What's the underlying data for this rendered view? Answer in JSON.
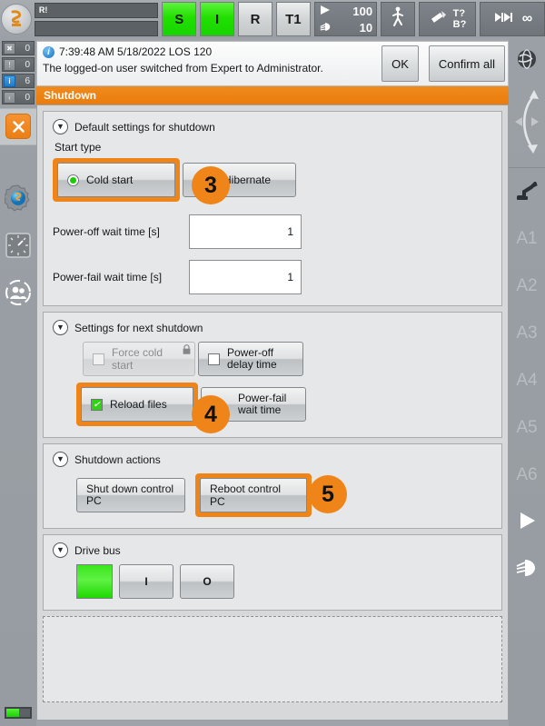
{
  "topbar": {
    "logo_icon": "kuka-robot-logo-icon",
    "status_field_1": "R!",
    "status_field_2": "",
    "buttons": [
      {
        "name": "submit-interpreter",
        "label": "S",
        "style": "green"
      },
      {
        "name": "drives-ready",
        "label": "I",
        "style": "green"
      },
      {
        "name": "robot-interpreter",
        "label": "R",
        "style": "gray"
      },
      {
        "name": "operating-mode",
        "label": "T1",
        "style": "gray"
      }
    ],
    "program_override": "100",
    "jog_override": "10",
    "play_icon": "play-triangle-icon",
    "hand_icon": "jog-hand-icon",
    "walk_icon": "walking-person-icon",
    "tool_icon": "tool-base-icon",
    "tool_label": "T?",
    "base_label": "B?",
    "incremental_icon": "step-mode-icon",
    "increment_label": "∞"
  },
  "left_rail": {
    "counters": [
      {
        "name": "acknowledge-messages",
        "icon": "ack-message-icon",
        "count": "0"
      },
      {
        "name": "state-messages",
        "icon": "warning-message-icon",
        "count": "0"
      },
      {
        "name": "info-messages",
        "icon": "info-message-icon",
        "count": "6"
      },
      {
        "name": "wait-messages",
        "icon": "wait-message-icon",
        "count": "0"
      }
    ],
    "close_label": "✕",
    "icons": [
      {
        "name": "robot-configuration-icon",
        "label": "robot-gear-icon"
      },
      {
        "name": "clock-icon",
        "label": "clock-dial-icon"
      },
      {
        "name": "user-group-icon",
        "label": "users-icon"
      }
    ],
    "battery_icon": "battery-indicator-icon"
  },
  "right_rail": {
    "globe_icon": "world-coordinate-globe-icon",
    "nav_icon": "curved-jog-arrows-icon",
    "robot_icon": "robot-axis-icon",
    "axes": [
      "A1",
      "A2",
      "A3",
      "A4",
      "A5",
      "A6"
    ],
    "play_icon": "play-triangle-icon",
    "hand_icon": "jog-hand-icon"
  },
  "message": {
    "info_icon": "info-icon",
    "timestamp": "7:39:48 AM 5/18/2022 LOS 120",
    "text": "The logged-on user switched from Expert to Administrator.",
    "ok_label": "OK",
    "confirm_all_label": "Confirm all"
  },
  "title": "Shutdown",
  "panels": {
    "default_settings": {
      "title": "Default settings for shutdown",
      "start_type_label": "Start type",
      "cold_start_label": "Cold start",
      "cold_start_selected": true,
      "hibernate_label": "Hibernate",
      "power_off_wait_label": "Power-off wait time [s]",
      "power_off_wait_value": "1",
      "power_fail_wait_label": "Power-fail wait time [s]",
      "power_fail_wait_value": "1",
      "badge": "3"
    },
    "next_shutdown": {
      "title": "Settings for next shutdown",
      "force_cold_start_label": "Force cold start",
      "force_cold_start_checked": false,
      "force_cold_start_locked": true,
      "power_off_delay_label": "Power-off delay time",
      "power_off_delay_checked": false,
      "reload_files_label": "Reload files",
      "reload_files_checked": true,
      "power_fail_wait_label": "Power-fail wait time",
      "power_fail_wait_checked": false,
      "badge": "4"
    },
    "shutdown_actions": {
      "title": "Shutdown actions",
      "shut_down_label": "Shut down control PC",
      "reboot_label": "Reboot control PC",
      "badge": "5"
    },
    "drive_bus": {
      "title": "Drive bus",
      "led_state": "green",
      "on_label": "I",
      "off_label": "O"
    }
  },
  "colors": {
    "accent_orange": "#ef8518",
    "title_orange": "#ea7c0c",
    "led_green": "#17cf00",
    "panel_bg": "#e6e7e8",
    "chrome_gray": "#9aa0a5"
  }
}
